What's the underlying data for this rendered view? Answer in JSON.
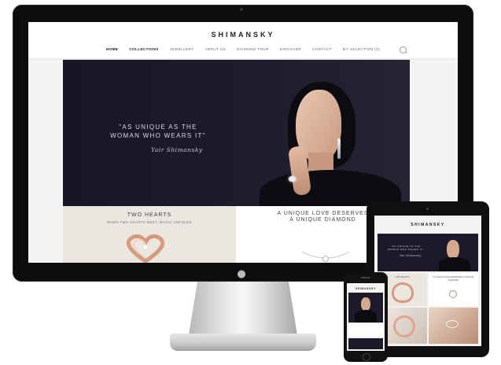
{
  "site": {
    "logo": "SHIMANSKY",
    "nav": [
      "HOME",
      "COLLECTIONS",
      "JEWELLERY",
      "ABOUT US",
      "DIAMOND TOUR",
      "DISCOVER",
      "CONTACT",
      "MY SELECTION (0)"
    ],
    "active_nav": "HOME",
    "hero": {
      "quote_line1": "\"AS UNIQUE AS THE",
      "quote_line2": "WOMAN WHO WEARS IT\"",
      "signature": "Yair Shimansky"
    },
    "panels": [
      {
        "title": "TWO HEARTS",
        "subtitle": "WHEN TWO HEARTS MEET, MAGIC UNFOLDS"
      },
      {
        "title_line1": "A UNIQUE LOVE DESERVES",
        "title_line2": "A UNIQUE DIAMOND"
      }
    ]
  },
  "ipad": {
    "logo": "SHIMANSKY",
    "quote_line1": "\"AS UNIQUE AS THE",
    "quote_line2": "WOMAN WHO WEARS IT\"",
    "signature": "Yair Shimansky",
    "tiles": [
      "TWO HEARTS",
      "A UNIQUE LOVE DESERVES A UNIQUE DIAMOND"
    ]
  },
  "iphone": {
    "logo": "SHIMANSKY"
  },
  "colors": {
    "hero_background": "#1a1a2a",
    "panel_blush": "#ece6e1",
    "device_black": "#0d0d0d"
  },
  "icons": [
    "apple-logo-icon",
    "search-icon"
  ]
}
